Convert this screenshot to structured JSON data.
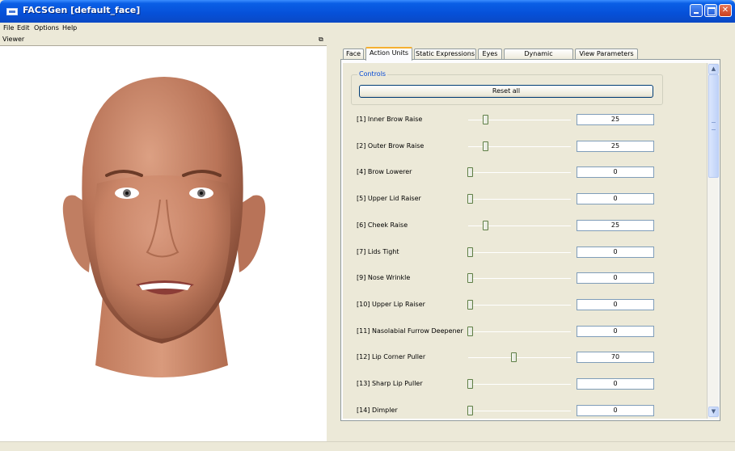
{
  "window": {
    "title": "FACSGen [default_face]"
  },
  "menu": [
    "File",
    "Edit",
    "Options",
    "Help"
  ],
  "viewer": {
    "title": "Viewer"
  },
  "tabs": [
    "Face",
    "Action Units",
    "Static Expressions",
    "Eyes",
    "Dynamic Expressions",
    "View Parameters"
  ],
  "active_tab": "Action Units",
  "controls": {
    "group_title": "Controls",
    "reset_label": "Reset all"
  },
  "action_units": [
    {
      "label": "[1] Inner Brow Raise",
      "value": "25"
    },
    {
      "label": "[2] Outer Brow Raise",
      "value": "25"
    },
    {
      "label": "[4] Brow Lowerer",
      "value": "0"
    },
    {
      "label": "[5] Upper Lid Raiser",
      "value": "0"
    },
    {
      "label": "[6] Cheek Raise",
      "value": "25"
    },
    {
      "label": "[7] Lids Tight",
      "value": "0"
    },
    {
      "label": "[9] Nose Wrinkle",
      "value": "0"
    },
    {
      "label": "[10] Upper Lip Raiser",
      "value": "0"
    },
    {
      "label": "[11] Nasolabial Furrow Deepener",
      "value": "0"
    },
    {
      "label": "[12] Lip Corner Puller",
      "value": "70"
    },
    {
      "label": "[13] Sharp Lip Puller",
      "value": "0"
    },
    {
      "label": "[14] Dimpler",
      "value": "0"
    }
  ],
  "colors": {
    "titlebar": "#0650d8",
    "group_title": "#0046d5",
    "active_tab_accent": "#f5b030"
  }
}
